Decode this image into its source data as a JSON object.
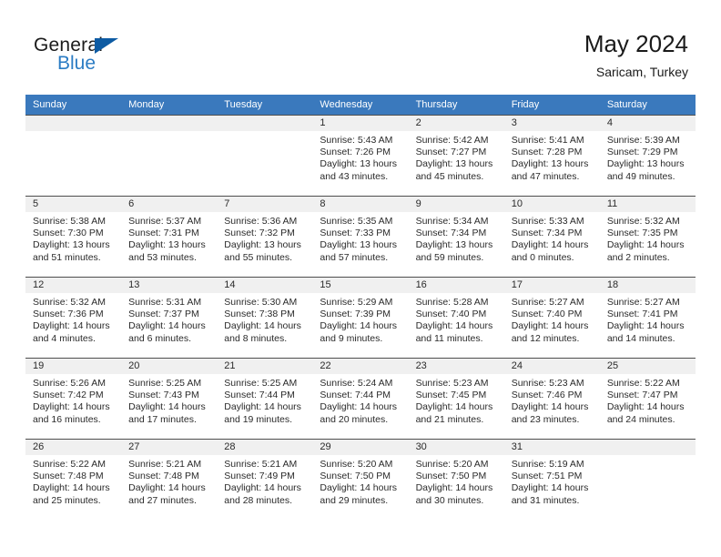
{
  "brand": {
    "name_part1": "General",
    "name_part2": "Blue",
    "triangle_color": "#0d5ba3",
    "blue_color": "#2b7cc4"
  },
  "header": {
    "title": "May 2024",
    "location": "Saricam, Turkey"
  },
  "theme": {
    "header_row_bg": "#3a79bd",
    "daynum_band_bg": "#f0f0f0",
    "grid_line": "#4e4e4e",
    "text": "#2a2a2a"
  },
  "weekday_headers": [
    "Sunday",
    "Monday",
    "Tuesday",
    "Wednesday",
    "Thursday",
    "Friday",
    "Saturday"
  ],
  "weeks": [
    [
      {
        "day": "",
        "blank": true,
        "sunrise": "",
        "sunset": "",
        "daylight1": "",
        "daylight2": ""
      },
      {
        "day": "",
        "blank": true,
        "sunrise": "",
        "sunset": "",
        "daylight1": "",
        "daylight2": ""
      },
      {
        "day": "",
        "blank": true,
        "sunrise": "",
        "sunset": "",
        "daylight1": "",
        "daylight2": ""
      },
      {
        "day": "1",
        "blank": false,
        "sunrise": "Sunrise: 5:43 AM",
        "sunset": "Sunset: 7:26 PM",
        "daylight1": "Daylight: 13 hours",
        "daylight2": "and 43 minutes."
      },
      {
        "day": "2",
        "blank": false,
        "sunrise": "Sunrise: 5:42 AM",
        "sunset": "Sunset: 7:27 PM",
        "daylight1": "Daylight: 13 hours",
        "daylight2": "and 45 minutes."
      },
      {
        "day": "3",
        "blank": false,
        "sunrise": "Sunrise: 5:41 AM",
        "sunset": "Sunset: 7:28 PM",
        "daylight1": "Daylight: 13 hours",
        "daylight2": "and 47 minutes."
      },
      {
        "day": "4",
        "blank": false,
        "sunrise": "Sunrise: 5:39 AM",
        "sunset": "Sunset: 7:29 PM",
        "daylight1": "Daylight: 13 hours",
        "daylight2": "and 49 minutes."
      }
    ],
    [
      {
        "day": "5",
        "blank": false,
        "sunrise": "Sunrise: 5:38 AM",
        "sunset": "Sunset: 7:30 PM",
        "daylight1": "Daylight: 13 hours",
        "daylight2": "and 51 minutes."
      },
      {
        "day": "6",
        "blank": false,
        "sunrise": "Sunrise: 5:37 AM",
        "sunset": "Sunset: 7:31 PM",
        "daylight1": "Daylight: 13 hours",
        "daylight2": "and 53 minutes."
      },
      {
        "day": "7",
        "blank": false,
        "sunrise": "Sunrise: 5:36 AM",
        "sunset": "Sunset: 7:32 PM",
        "daylight1": "Daylight: 13 hours",
        "daylight2": "and 55 minutes."
      },
      {
        "day": "8",
        "blank": false,
        "sunrise": "Sunrise: 5:35 AM",
        "sunset": "Sunset: 7:33 PM",
        "daylight1": "Daylight: 13 hours",
        "daylight2": "and 57 minutes."
      },
      {
        "day": "9",
        "blank": false,
        "sunrise": "Sunrise: 5:34 AM",
        "sunset": "Sunset: 7:34 PM",
        "daylight1": "Daylight: 13 hours",
        "daylight2": "and 59 minutes."
      },
      {
        "day": "10",
        "blank": false,
        "sunrise": "Sunrise: 5:33 AM",
        "sunset": "Sunset: 7:34 PM",
        "daylight1": "Daylight: 14 hours",
        "daylight2": "and 0 minutes."
      },
      {
        "day": "11",
        "blank": false,
        "sunrise": "Sunrise: 5:32 AM",
        "sunset": "Sunset: 7:35 PM",
        "daylight1": "Daylight: 14 hours",
        "daylight2": "and 2 minutes."
      }
    ],
    [
      {
        "day": "12",
        "blank": false,
        "sunrise": "Sunrise: 5:32 AM",
        "sunset": "Sunset: 7:36 PM",
        "daylight1": "Daylight: 14 hours",
        "daylight2": "and 4 minutes."
      },
      {
        "day": "13",
        "blank": false,
        "sunrise": "Sunrise: 5:31 AM",
        "sunset": "Sunset: 7:37 PM",
        "daylight1": "Daylight: 14 hours",
        "daylight2": "and 6 minutes."
      },
      {
        "day": "14",
        "blank": false,
        "sunrise": "Sunrise: 5:30 AM",
        "sunset": "Sunset: 7:38 PM",
        "daylight1": "Daylight: 14 hours",
        "daylight2": "and 8 minutes."
      },
      {
        "day": "15",
        "blank": false,
        "sunrise": "Sunrise: 5:29 AM",
        "sunset": "Sunset: 7:39 PM",
        "daylight1": "Daylight: 14 hours",
        "daylight2": "and 9 minutes."
      },
      {
        "day": "16",
        "blank": false,
        "sunrise": "Sunrise: 5:28 AM",
        "sunset": "Sunset: 7:40 PM",
        "daylight1": "Daylight: 14 hours",
        "daylight2": "and 11 minutes."
      },
      {
        "day": "17",
        "blank": false,
        "sunrise": "Sunrise: 5:27 AM",
        "sunset": "Sunset: 7:40 PM",
        "daylight1": "Daylight: 14 hours",
        "daylight2": "and 12 minutes."
      },
      {
        "day": "18",
        "blank": false,
        "sunrise": "Sunrise: 5:27 AM",
        "sunset": "Sunset: 7:41 PM",
        "daylight1": "Daylight: 14 hours",
        "daylight2": "and 14 minutes."
      }
    ],
    [
      {
        "day": "19",
        "blank": false,
        "sunrise": "Sunrise: 5:26 AM",
        "sunset": "Sunset: 7:42 PM",
        "daylight1": "Daylight: 14 hours",
        "daylight2": "and 16 minutes."
      },
      {
        "day": "20",
        "blank": false,
        "sunrise": "Sunrise: 5:25 AM",
        "sunset": "Sunset: 7:43 PM",
        "daylight1": "Daylight: 14 hours",
        "daylight2": "and 17 minutes."
      },
      {
        "day": "21",
        "blank": false,
        "sunrise": "Sunrise: 5:25 AM",
        "sunset": "Sunset: 7:44 PM",
        "daylight1": "Daylight: 14 hours",
        "daylight2": "and 19 minutes."
      },
      {
        "day": "22",
        "blank": false,
        "sunrise": "Sunrise: 5:24 AM",
        "sunset": "Sunset: 7:44 PM",
        "daylight1": "Daylight: 14 hours",
        "daylight2": "and 20 minutes."
      },
      {
        "day": "23",
        "blank": false,
        "sunrise": "Sunrise: 5:23 AM",
        "sunset": "Sunset: 7:45 PM",
        "daylight1": "Daylight: 14 hours",
        "daylight2": "and 21 minutes."
      },
      {
        "day": "24",
        "blank": false,
        "sunrise": "Sunrise: 5:23 AM",
        "sunset": "Sunset: 7:46 PM",
        "daylight1": "Daylight: 14 hours",
        "daylight2": "and 23 minutes."
      },
      {
        "day": "25",
        "blank": false,
        "sunrise": "Sunrise: 5:22 AM",
        "sunset": "Sunset: 7:47 PM",
        "daylight1": "Daylight: 14 hours",
        "daylight2": "and 24 minutes."
      }
    ],
    [
      {
        "day": "26",
        "blank": false,
        "sunrise": "Sunrise: 5:22 AM",
        "sunset": "Sunset: 7:48 PM",
        "daylight1": "Daylight: 14 hours",
        "daylight2": "and 25 minutes."
      },
      {
        "day": "27",
        "blank": false,
        "sunrise": "Sunrise: 5:21 AM",
        "sunset": "Sunset: 7:48 PM",
        "daylight1": "Daylight: 14 hours",
        "daylight2": "and 27 minutes."
      },
      {
        "day": "28",
        "blank": false,
        "sunrise": "Sunrise: 5:21 AM",
        "sunset": "Sunset: 7:49 PM",
        "daylight1": "Daylight: 14 hours",
        "daylight2": "and 28 minutes."
      },
      {
        "day": "29",
        "blank": false,
        "sunrise": "Sunrise: 5:20 AM",
        "sunset": "Sunset: 7:50 PM",
        "daylight1": "Daylight: 14 hours",
        "daylight2": "and 29 minutes."
      },
      {
        "day": "30",
        "blank": false,
        "sunrise": "Sunrise: 5:20 AM",
        "sunset": "Sunset: 7:50 PM",
        "daylight1": "Daylight: 14 hours",
        "daylight2": "and 30 minutes."
      },
      {
        "day": "31",
        "blank": false,
        "sunrise": "Sunrise: 5:19 AM",
        "sunset": "Sunset: 7:51 PM",
        "daylight1": "Daylight: 14 hours",
        "daylight2": "and 31 minutes."
      },
      {
        "day": "",
        "blank": true,
        "sunrise": "",
        "sunset": "",
        "daylight1": "",
        "daylight2": ""
      }
    ]
  ]
}
